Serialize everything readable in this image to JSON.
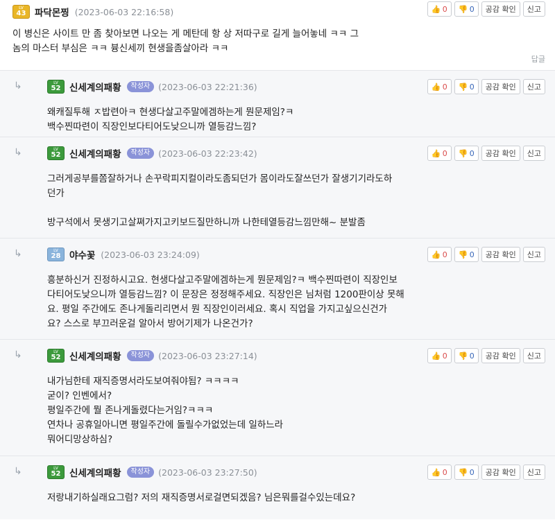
{
  "top": {
    "level": "43",
    "level_label": "LV",
    "nick": "파닥몬찡",
    "time": "(2023-06-03 22:16:58)",
    "like": "0",
    "dislike": "0",
    "empathy": "공감 확인",
    "report": "신고",
    "text": "이 병신은 사이트 만 좀 찾아보면 나오는 게 메탄데 항 상 저따구로 길게 늘어놓네 ㅋㅋ 그\n놈의 마스터 부심은 ㅋㅋ 븅신세끼 현생을좀살아라 ㅋㅋ",
    "reply_link": "답글"
  },
  "replies": [
    {
      "level": "52",
      "level_label": "LV",
      "level_color": "green",
      "nick": "신세계의패황",
      "badge": "작성자",
      "time": "(2023-06-03 22:21:36)",
      "like": "0",
      "dislike": "0",
      "empathy": "공감 확인",
      "report": "신고",
      "text": "왜캐질투해 ㅈ밥련아ㅋ 현생다살고주말에겜하는게 뭔문제임?ㅋ\n백수찐따련이 직장인보다티어도낮으니까 열등감느낌?"
    },
    {
      "level": "52",
      "level_label": "LV",
      "level_color": "green",
      "nick": "신세계의패황",
      "badge": "작성자",
      "time": "(2023-06-03 22:23:42)",
      "like": "0",
      "dislike": "0",
      "empathy": "공감 확인",
      "report": "신고",
      "text": "그러게공부를쫌잘하거나 손꾸락피지컬이라도좀되던가 몸이라도잘쓰던가 잘생기기라도하\n던가\n\n방구석에서 못생기고살쪄가지고키보드질만하니까 나한테열등감느낌만해~ 분발좀"
    },
    {
      "level": "28",
      "level_label": "LV",
      "level_color": "blue",
      "nick": "야수꽃",
      "badge": "",
      "time": "(2023-06-03 23:24:09)",
      "like": "0",
      "dislike": "0",
      "empathy": "공감 확인",
      "report": "신고",
      "text": "흥분하신거 진정하시고요. 현생다살고주말에겜하는게 뭔문제임?ㅋ 백수찐따련이 직장인보\n다티어도낮으니까 열등감느낌? 이 문장은 정정해주세요. 직장인은 님처럼 1200판이상 못해\n요. 평일 주간에도 존나게돌리리면서 뭔 직장인이러세요. 혹시 직업을 가지고싶으신건가\n요? 스스로 부끄러운걸 알아서 방어기제가 나온건가?"
    },
    {
      "level": "52",
      "level_label": "LV",
      "level_color": "green",
      "nick": "신세계의패황",
      "badge": "작성자",
      "time": "(2023-06-03 23:27:14)",
      "like": "0",
      "dislike": "0",
      "empathy": "공감 확인",
      "report": "신고",
      "text": "내가님한테 재직증명서라도보여줘야됨? ㅋㅋㅋㅋ\n굳이? 인벤에서?\n평일주간에 뭘 존나게돌렸다는거임?ㅋㅋㅋ\n연차나 공휴일아니면 평일주간에 돌릴수가없었는데 일하느라\n뭐어디망상하심?"
    },
    {
      "level": "52",
      "level_label": "LV",
      "level_color": "green",
      "nick": "신세계의패황",
      "badge": "작성자",
      "time": "(2023-06-03 23:27:50)",
      "like": "0",
      "dislike": "0",
      "empathy": "공감 확인",
      "report": "신고",
      "text": "저랑내기하실래요그럼? 저의 재직증명서로걸면되겠음? 님은뭐를걸수있는데요?"
    }
  ]
}
